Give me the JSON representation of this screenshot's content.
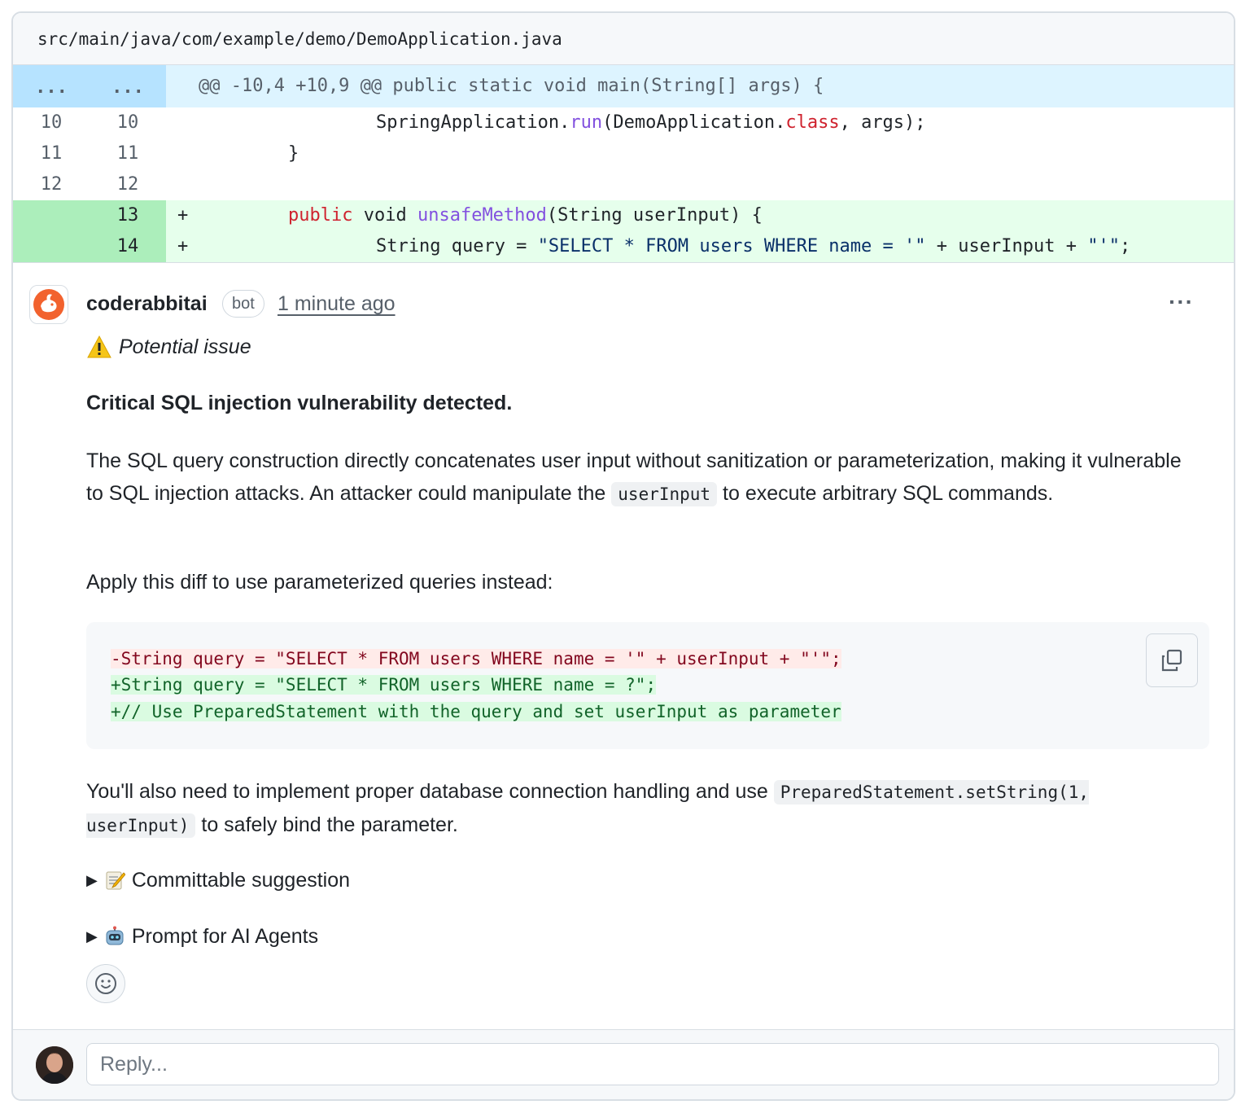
{
  "file": {
    "path": "src/main/java/com/example/demo/DemoApplication.java"
  },
  "hunk": {
    "old_marker": "...",
    "new_marker": "...",
    "header": "@@ -10,4 +10,9 @@ public static void main(String[] args) {"
  },
  "diff_lines": [
    {
      "old": "10",
      "new": "10",
      "sign": "",
      "segments": [
        "SpringApplication.",
        "run",
        "(DemoApplication.",
        "class",
        ", args);"
      ]
    },
    {
      "old": "11",
      "new": "11",
      "sign": "",
      "code": "}"
    },
    {
      "old": "12",
      "new": "12",
      "sign": "",
      "code": ""
    },
    {
      "old": "",
      "new": "13",
      "sign": "+",
      "segments": [
        "public",
        " void ",
        "unsafeMethod",
        "(String userInput) {"
      ]
    },
    {
      "old": "",
      "new": "14",
      "sign": "+",
      "segments": [
        "String query = ",
        "\"SELECT * FROM users WHERE name = '\"",
        " + userInput + ",
        "\"'\"",
        ";"
      ]
    }
  ],
  "comment": {
    "author": "coderabbitai",
    "badge": "bot",
    "time": "1 minute ago",
    "issue_label": "Potential issue",
    "heading": "Critical SQL injection vulnerability detected.",
    "para1_before": "The SQL query construction directly concatenates user input without sanitization or parameterization, making it vulnerable to SQL injection attacks. An attacker could manipulate the ",
    "para1_code": "userInput",
    "para1_after": " to execute arbitrary SQL commands.",
    "para2": "Apply this diff to use parameterized queries instead:",
    "suggestion": [
      "-String query = \"SELECT * FROM users WHERE name = '\" + userInput + \"'\";",
      "+String query = \"SELECT * FROM users WHERE name = ?\";",
      "+// Use PreparedStatement with the query and set userInput as parameter"
    ],
    "para3_before": "You'll also need to implement proper database connection handling and use ",
    "para3_code": "PreparedStatement.setString(1, userInput)",
    "para3_after": " to safely bind the parameter.",
    "details": [
      {
        "icon": "memo-icon",
        "label": "Committable suggestion"
      },
      {
        "icon": "robot-icon",
        "label": "Prompt for AI Agents"
      }
    ]
  },
  "reply": {
    "placeholder": "Reply..."
  },
  "colors": {
    "added_bg": "#e6ffec",
    "added_gutter": "#aceebb",
    "hunk_bg": "#ddf4ff",
    "hunk_gutter": "#b6e3ff",
    "keyword": "#cf222e",
    "function": "#8250df",
    "string": "#0a3069"
  }
}
